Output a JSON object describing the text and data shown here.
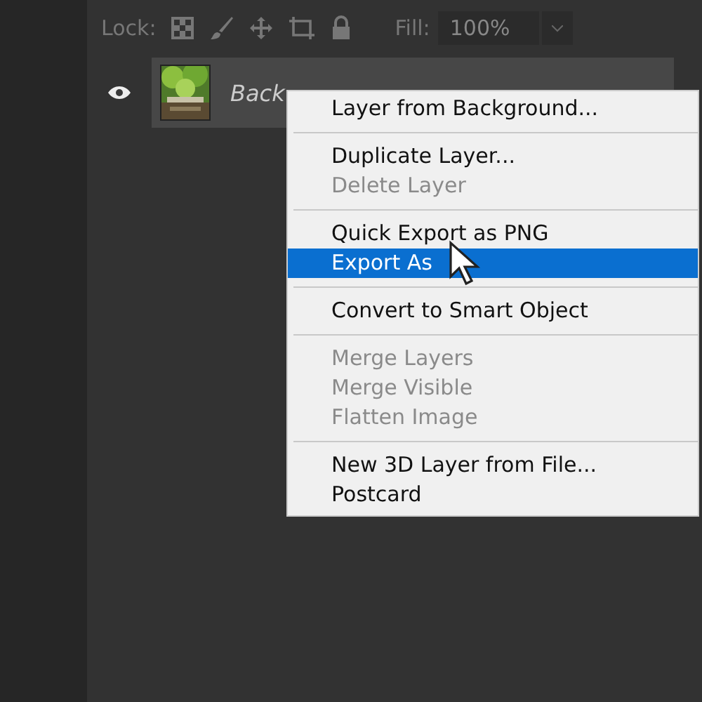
{
  "lock_bar": {
    "label": "Lock:",
    "fill_label": "Fill:",
    "fill_value": "100%"
  },
  "layer": {
    "name": "Back",
    "visible": true
  },
  "context_menu": {
    "groups": [
      {
        "items": [
          {
            "label": "Layer from Background...",
            "disabled": false,
            "selected": false
          }
        ]
      },
      {
        "items": [
          {
            "label": "Duplicate Layer...",
            "disabled": false,
            "selected": false
          },
          {
            "label": "Delete Layer",
            "disabled": true,
            "selected": false
          }
        ]
      },
      {
        "items": [
          {
            "label": "Quick Export as PNG",
            "disabled": false,
            "selected": false
          },
          {
            "label": "Export As",
            "disabled": false,
            "selected": true
          }
        ]
      },
      {
        "items": [
          {
            "label": "Convert to Smart Object",
            "disabled": false,
            "selected": false
          }
        ]
      },
      {
        "items": [
          {
            "label": "Merge Layers",
            "disabled": true,
            "selected": false
          },
          {
            "label": "Merge Visible",
            "disabled": true,
            "selected": false
          },
          {
            "label": "Flatten Image",
            "disabled": true,
            "selected": false
          }
        ]
      },
      {
        "items": [
          {
            "label": "New 3D Layer from File...",
            "disabled": false,
            "selected": false
          },
          {
            "label": "Postcard",
            "disabled": false,
            "selected": false
          }
        ]
      }
    ]
  }
}
